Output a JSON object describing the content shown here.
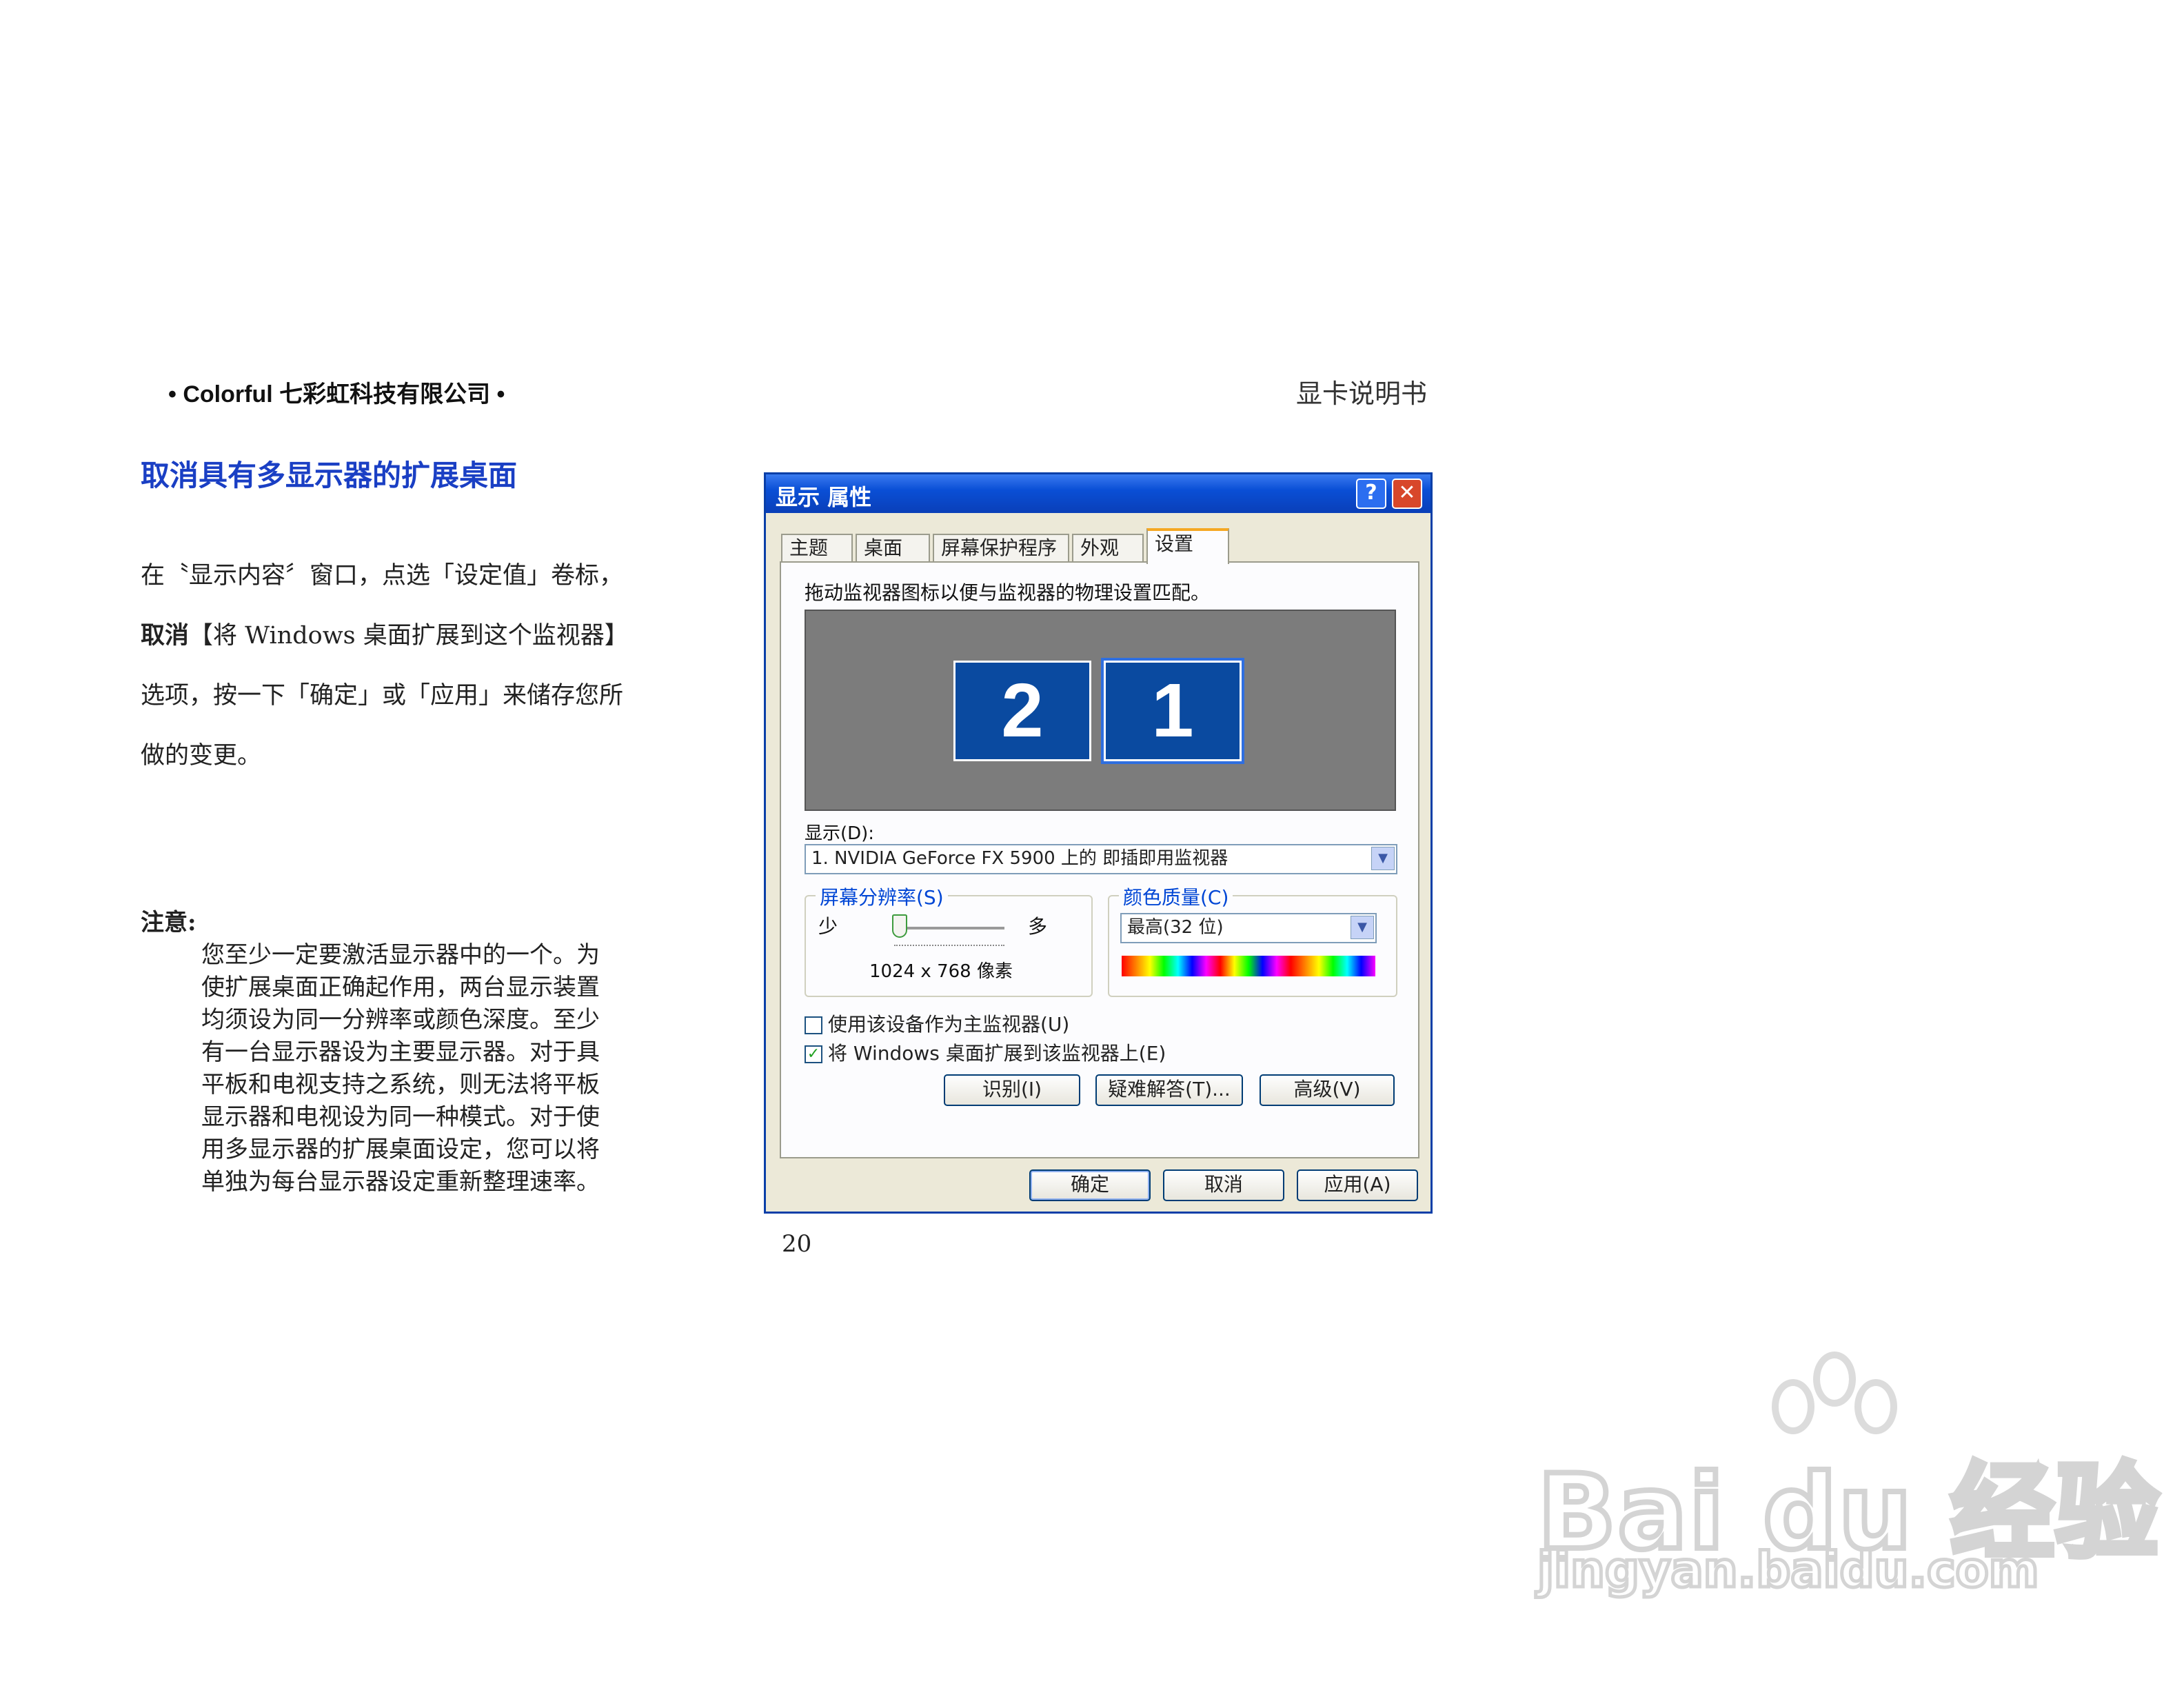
{
  "header": {
    "company": "• Colorful  七彩虹科技有限公司 •",
    "doc_title": "显卡说明书"
  },
  "section": {
    "title": "取消具有多显示器的扩展桌面",
    "lines": [
      "在〝显示内容〞窗口，点选「设定值」卷标，",
      "取消【将 Windows 桌面扩展到这个监视器】",
      "选项，按一下「确定」或「应用」来储存您所",
      "做的变更。"
    ],
    "line2_bold": "取消",
    "line2_rest": "【将 Windows 桌面扩展到这个监视器】"
  },
  "note": {
    "title": "注意:",
    "lines": [
      "您至少一定要激活显示器中的一个。为",
      "使扩展桌面正确起作用，两台显示装置",
      "均须设为同一分辨率或颜色深度。至少",
      "有一台显示器设为主要显示器。对于具",
      "平板和电视支持之系统，则无法将平板",
      "显示器和电视设为同一种模式。对于使",
      "用多显示器的扩展桌面设定，您可以将",
      "单独为每台显示器设定重新整理速率。"
    ]
  },
  "page_number": "20",
  "dialog": {
    "title": "显示 属性",
    "help_button": "?",
    "close_button": "✕",
    "tabs": [
      "主题",
      "桌面",
      "屏幕保护程序",
      "外观",
      "设置"
    ],
    "active_tab": "设置",
    "instruction": "拖动监视器图标以便与监视器的物理设置匹配。",
    "monitors": [
      "2",
      "1"
    ],
    "display_label": "显示(D):",
    "display_value": "1. NVIDIA GeForce FX 5900 上的 即插即用监视器",
    "resolution": {
      "label": "屏幕分辨率(S)",
      "less": "少",
      "more": "多",
      "value": "1024 x 768 像素",
      "slider_position": 0.05
    },
    "color_quality": {
      "label": "颜色质量(C)",
      "value": "最高(32 位)"
    },
    "checkboxes": [
      {
        "label": "使用该设备作为主监视器(U)",
        "checked": false
      },
      {
        "label": "将 Windows 桌面扩展到该监视器上(E)",
        "checked": true
      }
    ],
    "buttons": {
      "identify": "识别(I)",
      "troubleshoot": "疑难解答(T)...",
      "advanced": "高级(V)",
      "ok": "确定",
      "cancel": "取消",
      "apply": "应用(A)"
    },
    "colors": {
      "titlebar": "#0a4fd6",
      "monitor_fill": "#0a4aa0",
      "desktop_area": "#7c7c7c",
      "link_blue": "#0046d5"
    }
  },
  "watermark": {
    "brand": "Bai du 经验",
    "url": "jingyan.baidu.com"
  }
}
